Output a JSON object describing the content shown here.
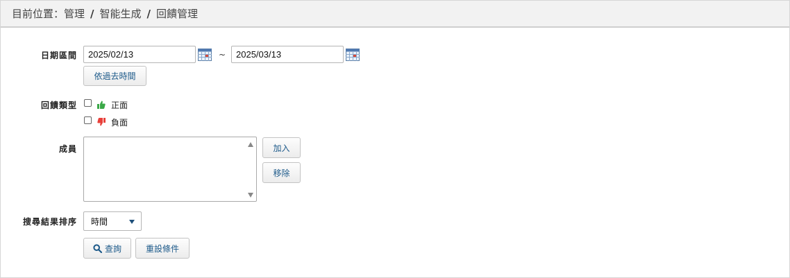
{
  "breadcrumb": {
    "prefix": "目前位置：管理",
    "sep1": "/",
    "item2": "智能生成",
    "sep2": "/",
    "item3": "回饋管理"
  },
  "form": {
    "date_range": {
      "label": "日期區間",
      "start": "2025/02/13",
      "tilde": "~",
      "end": "2025/03/13",
      "calendar_icon": "calendar-icon",
      "past_time_button": "依過去時間"
    },
    "feedback_type": {
      "label": "回饋類型",
      "options": [
        {
          "label": "正面",
          "icon": "thumbs-up-icon",
          "color": "#3aa847",
          "checked": false
        },
        {
          "label": "負面",
          "icon": "thumbs-down-icon",
          "color": "#e8403a",
          "checked": false
        }
      ]
    },
    "members": {
      "label": "成員",
      "add_button": "加入",
      "remove_button": "移除"
    },
    "sort": {
      "label": "搜尋結果排序",
      "selected": "時間"
    },
    "actions": {
      "search_button": "查詢",
      "reset_button": "重設條件"
    }
  }
}
